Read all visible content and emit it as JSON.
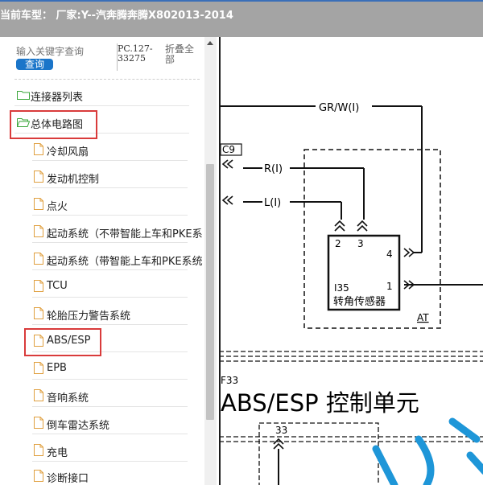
{
  "topbar": {
    "title": "当前车型： 厂家:Y--汽奔腾奔腾X802013-2014"
  },
  "search": {
    "placeholder": "输入关键字查询",
    "button_label": "查询",
    "pc_label": "PC.127-33275",
    "collapse_label": "折叠全部"
  },
  "tree": {
    "top_items": [
      {
        "label": "连接器列表"
      },
      {
        "label": "总体电路图"
      }
    ],
    "children": [
      {
        "label": "冷却风扇"
      },
      {
        "label": "发动机控制"
      },
      {
        "label": "点火"
      },
      {
        "label": "起动系统（不带智能上车和PKE系"
      },
      {
        "label": "起动系统（带智能上车和PKE系统"
      },
      {
        "label": "TCU"
      },
      {
        "label": "轮胎压力警告系统"
      },
      {
        "label": "ABS/ESP"
      },
      {
        "label": "EPB"
      },
      {
        "label": "音响系统"
      },
      {
        "label": "倒车雷达系统"
      },
      {
        "label": "充电"
      },
      {
        "label": "诊断接口"
      }
    ]
  },
  "diagram": {
    "wire_gr_w": "GR/W(I)",
    "connector_c9": "C9",
    "wire_r": "R(I)",
    "wire_l": "L(I)",
    "pin_2": "2",
    "pin_3": "3",
    "pin_4": "4",
    "pin_1": "1",
    "component_code": "I35",
    "component_name": "转角传感器",
    "at_label": "AT",
    "f33_label": "F33",
    "section_title": "ABS/ESP 控制单元",
    "pin_33": "33"
  },
  "colors": {
    "highlight": "#d93b3b",
    "search_button": "#1a75c9",
    "topbar": "#a4a4a4",
    "watermark": "#1e96d8"
  }
}
